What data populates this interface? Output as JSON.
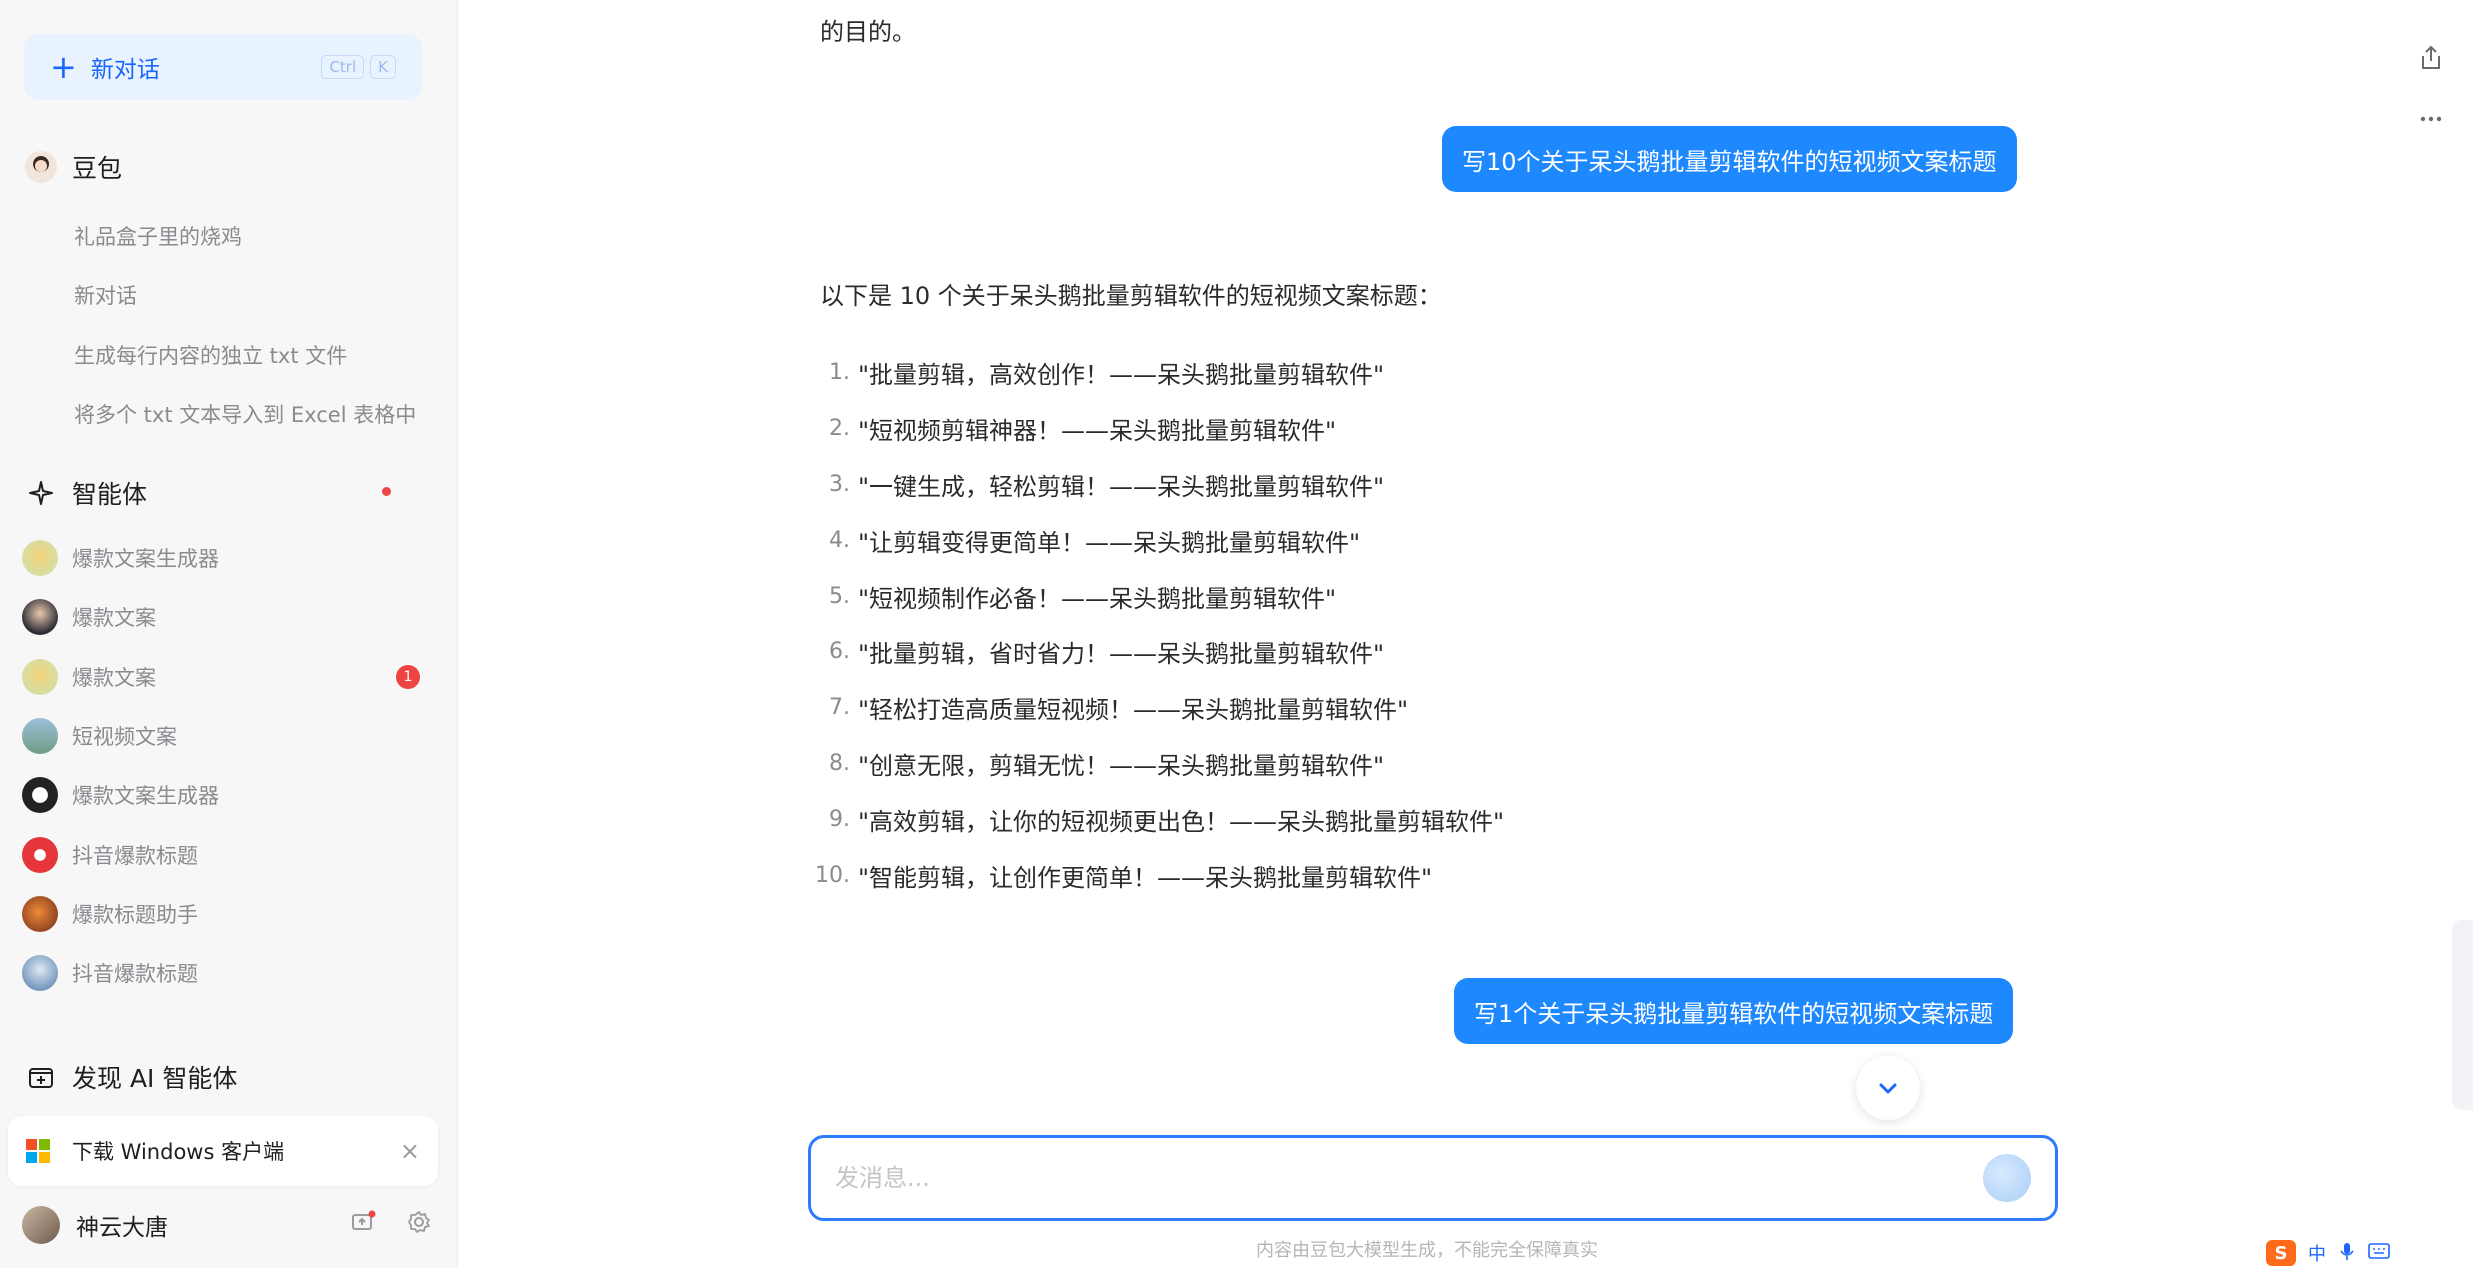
{
  "sidebar": {
    "new_chat_label": "新对话",
    "new_chat_shortcut": [
      "Ctrl",
      "K"
    ],
    "doubao_title": "豆包",
    "history": [
      "礼品盒子里的烧鸡",
      "新对话",
      "生成每行内容的独立 txt 文件",
      "将多个 txt 文本导入到 Excel 表格中"
    ],
    "agents_title": "智能体",
    "agents": [
      {
        "name": "爆款文案生成器",
        "badge": ""
      },
      {
        "name": "爆款文案",
        "badge": ""
      },
      {
        "name": "爆款文案",
        "badge": "1"
      },
      {
        "name": "短视频文案",
        "badge": ""
      },
      {
        "name": "爆款文案生成器",
        "badge": ""
      },
      {
        "name": "抖音爆款标题",
        "badge": ""
      },
      {
        "name": "爆款标题助手",
        "badge": ""
      },
      {
        "name": "抖音爆款标题",
        "badge": ""
      }
    ],
    "discover_label": "发现 AI 智能体",
    "download_label": "下载 Windows 客户端",
    "user_name": "神云大唐"
  },
  "chat": {
    "prev_fragment": "的目的。",
    "user_msg_1": "写10个关于呆头鹅批量剪辑软件的短视频文案标题",
    "answer_intro": "以下是 10 个关于呆头鹅批量剪辑软件的短视频文案标题：",
    "answer_items": [
      "\"批量剪辑，高效创作！——呆头鹅批量剪辑软件\"",
      "\"短视频剪辑神器！——呆头鹅批量剪辑软件\"",
      "\"一键生成，轻松剪辑！——呆头鹅批量剪辑软件\"",
      "\"让剪辑变得更简单！——呆头鹅批量剪辑软件\"",
      "\"短视频制作必备！——呆头鹅批量剪辑软件\"",
      "\"批量剪辑，省时省力！——呆头鹅批量剪辑软件\"",
      "\"轻松打造高质量短视频！——呆头鹅批量剪辑软件\"",
      "\"创意无限，剪辑无忧！——呆头鹅批量剪辑软件\"",
      "\"高效剪辑，让你的短视频更出色！——呆头鹅批量剪辑软件\"",
      "\"智能剪辑，让创作更简单！——呆头鹅批量剪辑软件\""
    ],
    "answer_numbers": [
      "1.",
      "2.",
      "3.",
      "4.",
      "5.",
      "6.",
      "7.",
      "8.",
      "9.",
      "10."
    ],
    "user_msg_2": "写1个关于呆头鹅批量剪辑软件的短视频文案标题"
  },
  "input": {
    "placeholder": "发消息...",
    "disclaimer": "内容由豆包大模型生成，不能完全保障真实"
  },
  "tray": {
    "ime_logo": "S",
    "ime_lang": "中"
  },
  "colors": {
    "accent": "#1e88ff",
    "sidebar_bg": "#f7f7f8",
    "badge": "#ef4444"
  }
}
